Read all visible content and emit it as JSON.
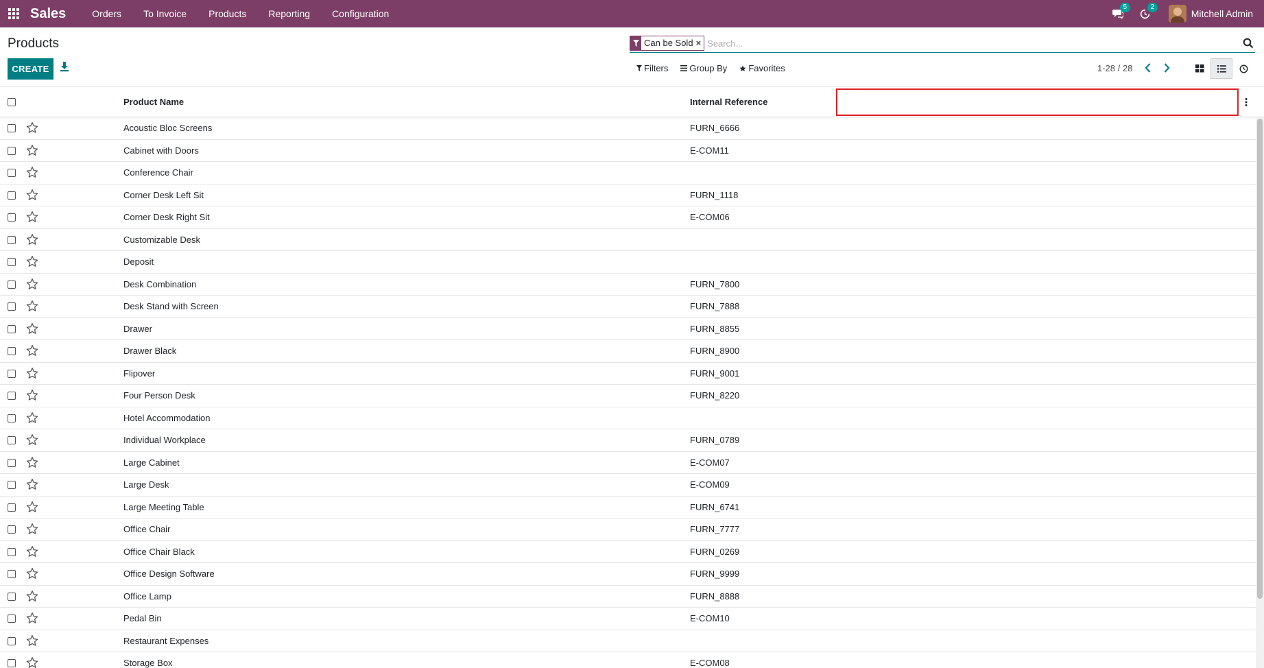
{
  "navbar": {
    "app_name": "Sales",
    "menu": [
      "Orders",
      "To Invoice",
      "Products",
      "Reporting",
      "Configuration"
    ],
    "messages_count": "5",
    "activities_count": "2",
    "user_name": "Mitchell Admin",
    "bg_color": "#7c3e66"
  },
  "control_panel": {
    "title": "Products",
    "create_label": "CREATE",
    "search": {
      "facet_label": "Can be Sold",
      "facet_remove": "×",
      "placeholder": "Search..."
    },
    "filters_label": "Filters",
    "group_by_label": "Group By",
    "favorites_label": "Favorites",
    "pager": "1-28 / 28"
  },
  "table": {
    "columns": [
      "Product Name",
      "Internal Reference"
    ],
    "rows": [
      {
        "name": "Acoustic Bloc Screens",
        "ref": "FURN_6666"
      },
      {
        "name": "Cabinet with Doors",
        "ref": "E-COM11"
      },
      {
        "name": "Conference Chair",
        "ref": ""
      },
      {
        "name": "Corner Desk Left Sit",
        "ref": "FURN_1118"
      },
      {
        "name": "Corner Desk Right Sit",
        "ref": "E-COM06"
      },
      {
        "name": "Customizable Desk",
        "ref": ""
      },
      {
        "name": "Deposit",
        "ref": ""
      },
      {
        "name": "Desk Combination",
        "ref": "FURN_7800"
      },
      {
        "name": "Desk Stand with Screen",
        "ref": "FURN_7888"
      },
      {
        "name": "Drawer",
        "ref": "FURN_8855"
      },
      {
        "name": "Drawer Black",
        "ref": "FURN_8900"
      },
      {
        "name": "Flipover",
        "ref": "FURN_9001"
      },
      {
        "name": "Four Person Desk",
        "ref": "FURN_8220"
      },
      {
        "name": "Hotel Accommodation",
        "ref": ""
      },
      {
        "name": "Individual Workplace",
        "ref": "FURN_0789"
      },
      {
        "name": "Large Cabinet",
        "ref": "E-COM07"
      },
      {
        "name": "Large Desk",
        "ref": "E-COM09"
      },
      {
        "name": "Large Meeting Table",
        "ref": "FURN_6741"
      },
      {
        "name": "Office Chair",
        "ref": "FURN_7777"
      },
      {
        "name": "Office Chair Black",
        "ref": "FURN_0269"
      },
      {
        "name": "Office Design Software",
        "ref": "FURN_9999"
      },
      {
        "name": "Office Lamp",
        "ref": "FURN_8888"
      },
      {
        "name": "Pedal Bin",
        "ref": "E-COM10"
      },
      {
        "name": "Restaurant Expenses",
        "ref": ""
      },
      {
        "name": "Storage Box",
        "ref": "E-COM08"
      }
    ]
  }
}
